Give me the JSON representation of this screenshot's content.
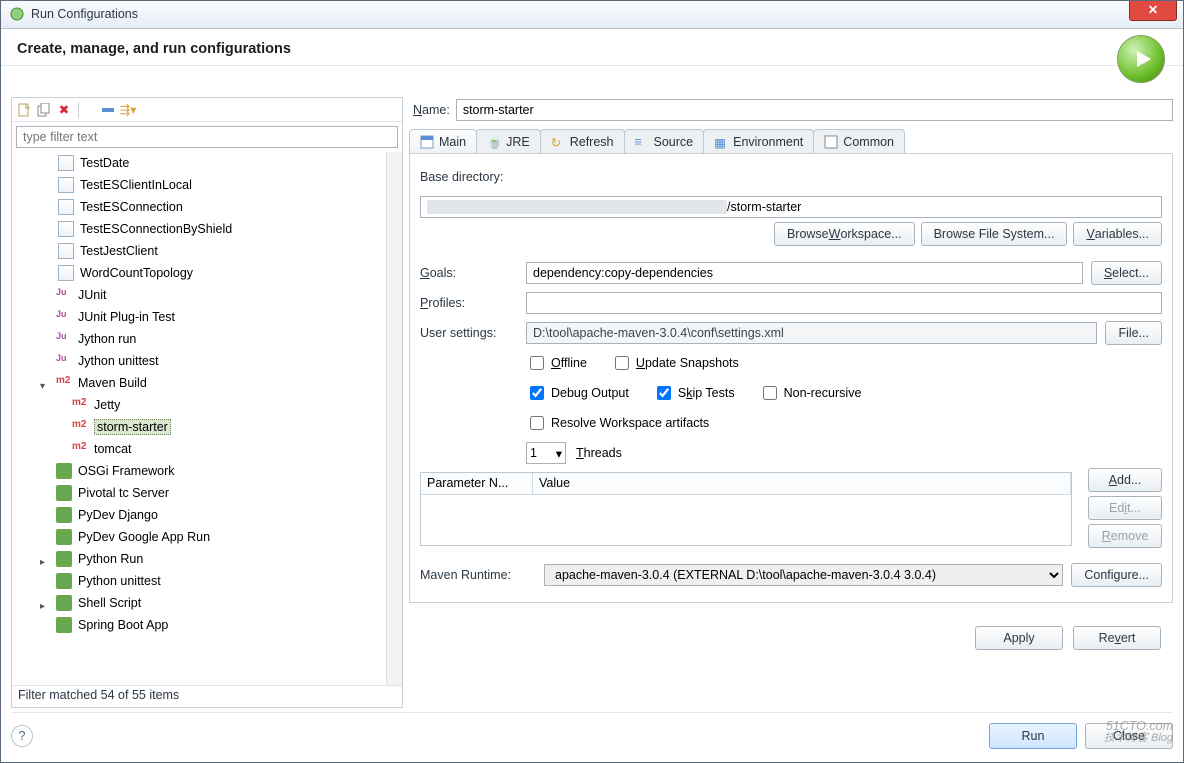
{
  "window": {
    "title": "Run Configurations"
  },
  "header": {
    "title": "Create, manage, and run configurations"
  },
  "left": {
    "filter_placeholder": "type filter text",
    "status": "Filter matched 54 of 55 items",
    "tree": {
      "files": [
        "TestDate",
        "TestESClientInLocal",
        "TestESConnection",
        "TestESConnectionByShield",
        "TestJestClient",
        "WordCountTopology"
      ],
      "categories": [
        {
          "label": "JUnit",
          "icon": "junit"
        },
        {
          "label": "JUnit Plug-in Test",
          "icon": "junit-plugin"
        },
        {
          "label": "Jython run",
          "icon": "jython"
        },
        {
          "label": "Jython unittest",
          "icon": "jython"
        }
      ],
      "maven": {
        "label": "Maven Build",
        "children": [
          {
            "label": "Jetty"
          },
          {
            "label": "storm-starter",
            "selected": true
          },
          {
            "label": "tomcat"
          }
        ]
      },
      "rest": [
        {
          "label": "OSGi Framework",
          "icon": "osgi"
        },
        {
          "label": "Pivotal tc Server",
          "icon": "pivotal"
        },
        {
          "label": "PyDev Django",
          "icon": "django"
        },
        {
          "label": "PyDev Google App Run",
          "icon": "gapp"
        },
        {
          "label": "Python Run",
          "icon": "python",
          "expandable": true
        },
        {
          "label": "Python unittest",
          "icon": "python"
        },
        {
          "label": "Shell Script",
          "icon": "shell",
          "expandable": true
        },
        {
          "label": "Spring Boot App",
          "icon": "spring"
        }
      ]
    }
  },
  "form": {
    "name_label": "Name:",
    "name_value": "storm-starter",
    "tabs": [
      "Main",
      "JRE",
      "Refresh",
      "Source",
      "Environment",
      "Common"
    ],
    "base_dir_label": "Base directory:",
    "base_dir_suffix": "/storm-starter",
    "browse_ws": "Browse Workspace...",
    "browse_fs": "Browse File System...",
    "variables": "Variables...",
    "goals_label": "Goals:",
    "goals_value": "dependency:copy-dependencies",
    "select": "Select...",
    "profiles_label": "Profiles:",
    "profiles_value": "",
    "user_settings_label": "User settings:",
    "user_settings_value": "D:\\tool\\apache-maven-3.0.4\\conf\\settings.xml",
    "file": "File...",
    "offline": "Offline",
    "update_snapshots": "Update Snapshots",
    "debug_output": "Debug Output",
    "skip_tests": "Skip Tests",
    "non_recursive": "Non-recursive",
    "resolve_ws": "Resolve Workspace artifacts",
    "threads_value": "1",
    "threads_label": "Threads",
    "param_name": "Parameter N...",
    "param_value": "Value",
    "add": "Add...",
    "edit": "Edit...",
    "remove": "Remove",
    "runtime_label": "Maven Runtime:",
    "runtime_value": "apache-maven-3.0.4 (EXTERNAL D:\\tool\\apache-maven-3.0.4 3.0.4)",
    "configure": "Configure...",
    "apply": "Apply",
    "revert": "Revert"
  },
  "footer": {
    "run": "Run",
    "close": "Close"
  },
  "watermark": {
    "top": "51CTO.com",
    "bottom": "技术博客  Blog"
  }
}
